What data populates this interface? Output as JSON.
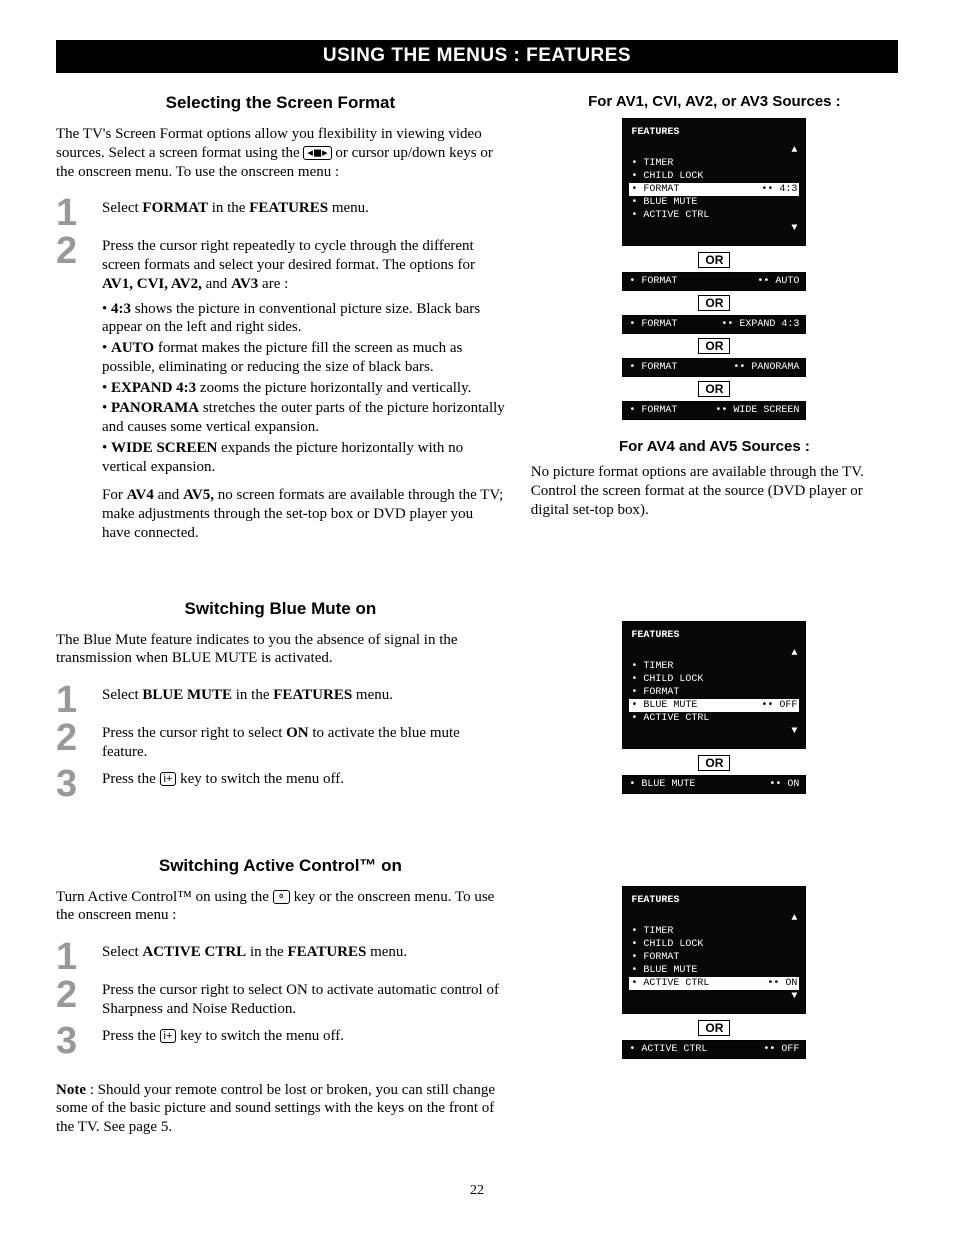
{
  "title_bar": "USING THE MENUS : FEATURES",
  "page_number": "22",
  "s1": {
    "heading": "Selecting the Screen Format",
    "intro_a": "The TV's Screen Format options allow you flexibility in viewing video sources. Select a screen format using the ",
    "intro_b": " or cursor up/down keys or the onscreen menu. To use the onscreen menu :",
    "step1_a": "Select ",
    "step1_b": "FORMAT",
    "step1_c": " in the ",
    "step1_d": "FEATURES",
    "step1_e": " menu.",
    "step2_a": "Press the cursor right repeatedly to cycle through the different screen formats and select your desired format. The options for ",
    "step2_b": "AV1, CVI, AV2,",
    "step2_c": " and ",
    "step2_d": "AV3",
    "step2_e": " are :",
    "bul1_a": "4:3",
    "bul1_b": " shows the picture in conventional picture size. Black bars appear on the left and right sides.",
    "bul2_a": "AUTO",
    "bul2_b": " format makes the picture fill the screen as much as possible, eliminating or reducing the size of black bars.",
    "bul3_a": "EXPAND 4:3",
    "bul3_b": " zooms the picture horizontally and vertically.",
    "bul4_a": "PANORAMA",
    "bul4_b": " stretches the outer parts of the picture horizontally and causes some vertical expansion.",
    "bul5_a": "WIDE SCREEN",
    "bul5_b": " expands the picture horizontally with no vertical expansion.",
    "tail_a": "For ",
    "tail_b": "AV4",
    "tail_c": " and ",
    "tail_d": "AV5,",
    "tail_e": " no screen formats are available through the TV; make adjustments through the set-top box or DVD player you have connected.",
    "right_heading": "For AV1, CVI, AV2, or AV3 Sources :",
    "menu_hdr": "FEATURES",
    "menu_items": {
      "timer": "• TIMER",
      "childlock": "• CHILD LOCK",
      "format": "• FORMAT",
      "format_val": "•• 4:3",
      "bluemute": "• BLUE MUTE",
      "activectrl": "• ACTIVE CTRL"
    },
    "or": "OR",
    "rows": {
      "auto_l": "• FORMAT",
      "auto_v": "•• AUTO",
      "exp_l": "• FORMAT",
      "exp_v": "•• EXPAND 4:3",
      "pan_l": "• FORMAT",
      "pan_v": "•• PANORAMA",
      "wide_l": "• FORMAT",
      "wide_v": "•• WIDE SCREEN"
    },
    "right2_heading": "For AV4 and AV5 Sources :",
    "right2_text": "No picture format options are available through the TV. Control the screen format at the source (DVD player or digital set-top box)."
  },
  "s2": {
    "heading": "Switching Blue Mute on",
    "intro": "The Blue Mute feature indicates to you the absence of signal in the transmission when BLUE MUTE is activated.",
    "step1_a": "Select ",
    "step1_b": "BLUE MUTE",
    "step1_c": " in the ",
    "step1_d": "FEATURES",
    "step1_e": " menu.",
    "step2_a": "Press the cursor right to select ",
    "step2_b": "ON",
    "step2_c": " to activate the blue mute feature.",
    "step3_a": "Press the ",
    "step3_b": " key to switch the menu off.",
    "menu_hdr": "FEATURES",
    "items": {
      "timer": "• TIMER",
      "childlock": "• CHILD LOCK",
      "format": "• FORMAT",
      "bluemute": "• BLUE MUTE",
      "bluemute_val": "•• OFF",
      "activectrl": "• ACTIVE CTRL"
    },
    "or": "OR",
    "on_l": "• BLUE MUTE",
    "on_v": "•• ON"
  },
  "s3": {
    "heading": "Switching Active Control™ on",
    "intro_a": "Turn Active Control™ on using the ",
    "intro_b": " key or the onscreen menu. To use the onscreen menu :",
    "step1_a": "Select ",
    "step1_b": "ACTIVE CTRL",
    "step1_c": " in the ",
    "step1_d": "FEATURES",
    "step1_e": " menu.",
    "step2": "Press the cursor right to select ON to activate automatic control of Sharpness and Noise Reduction.",
    "step3_a": "Press the ",
    "step3_b": " key to switch the menu off.",
    "menu_hdr": "FEATURES",
    "items": {
      "timer": "• TIMER",
      "childlock": "• CHILD LOCK",
      "format": "• FORMAT",
      "bluemute": "• BLUE MUTE",
      "activectrl": "• ACTIVE CTRL",
      "activectrl_val": "•• ON"
    },
    "or": "OR",
    "off_l": "• ACTIVE CTRL",
    "off_v": "•• OFF",
    "note_a": "Note",
    "note_b": " : Should your remote control be lost or broken, you can still change some of the basic picture and sound settings with the keys on the front of the TV. See page 5."
  }
}
